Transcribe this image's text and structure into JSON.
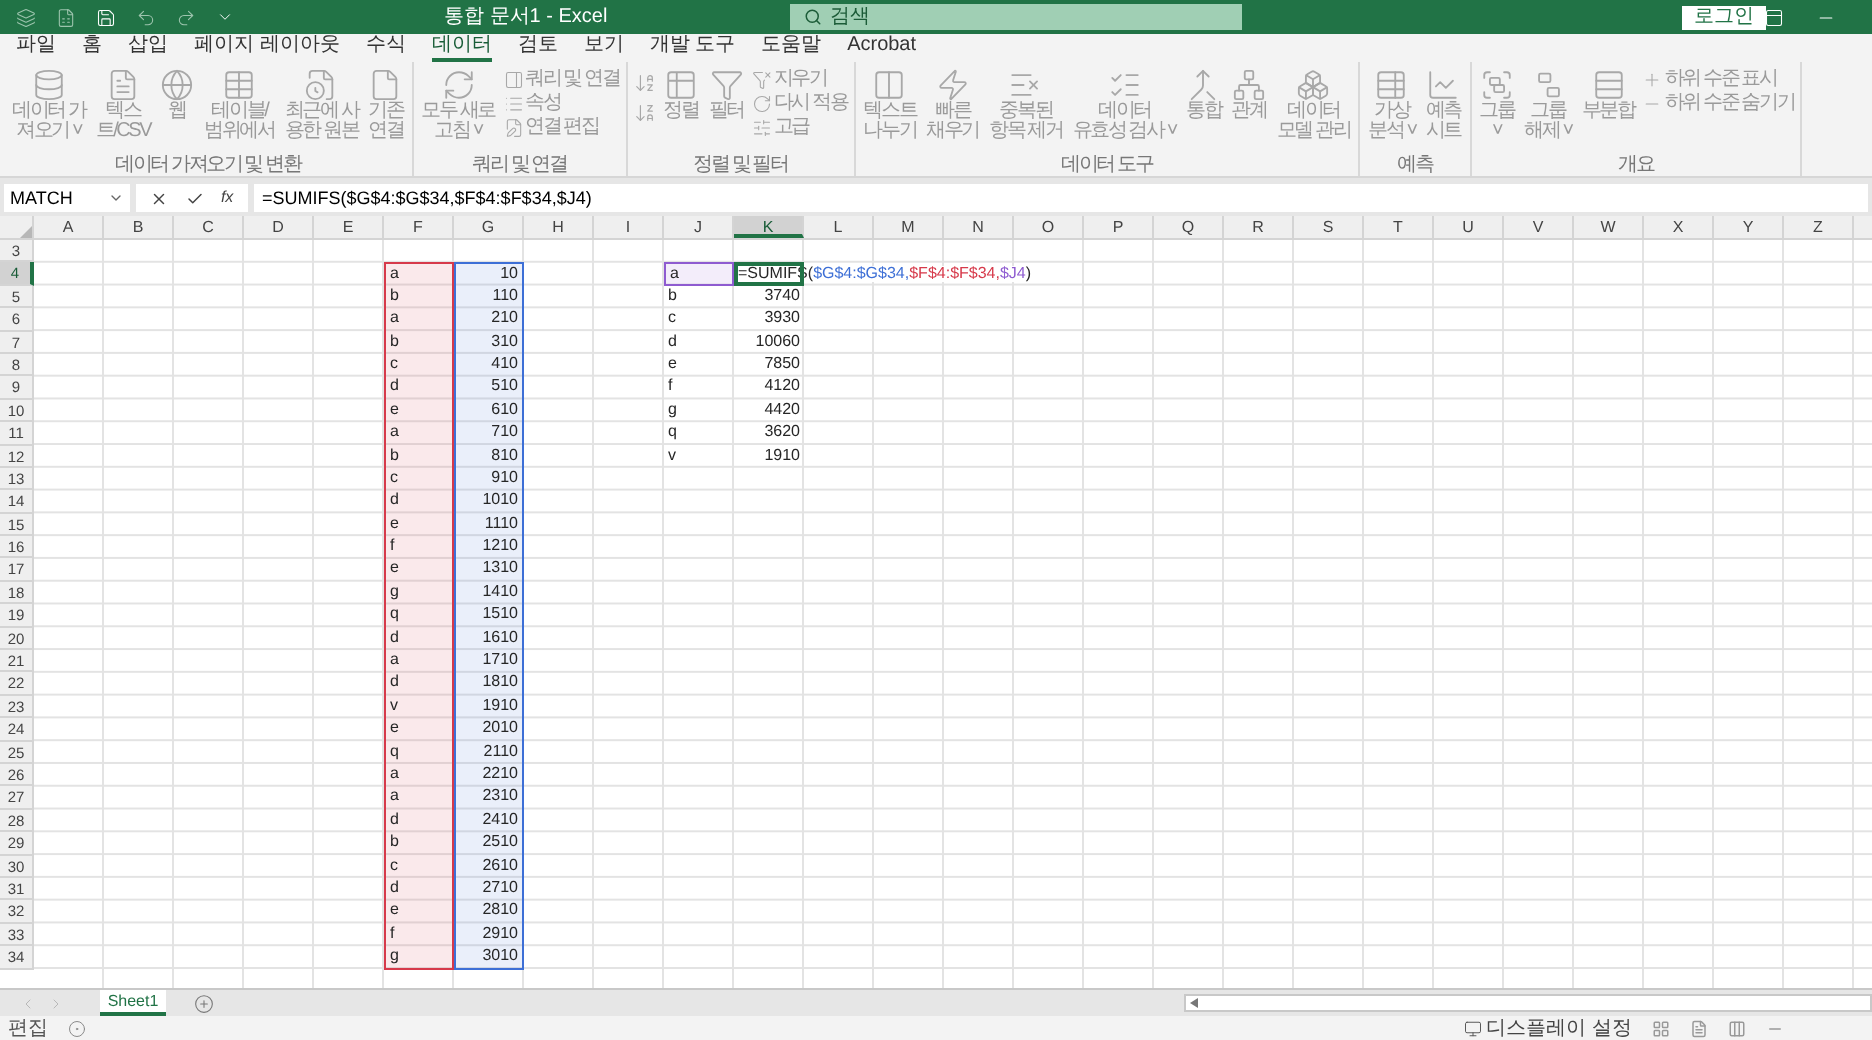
{
  "title_bar": {
    "title": "통합 문서1 - Excel",
    "search": {
      "placeholder": "검색"
    },
    "sign_in": "로그인"
  },
  "tabs": [
    {
      "label": "파일",
      "selected": false
    },
    {
      "label": "홈",
      "selected": false
    },
    {
      "label": "삽입",
      "selected": false
    },
    {
      "label": "페이지 레이아웃",
      "selected": false
    },
    {
      "label": "수식",
      "selected": false
    },
    {
      "label": "데이터",
      "selected": true
    },
    {
      "label": "검토",
      "selected": false
    },
    {
      "label": "보기",
      "selected": false
    },
    {
      "label": "개발 도구",
      "selected": false
    },
    {
      "label": "도움말",
      "selected": false
    },
    {
      "label": "Acrobat",
      "selected": false
    }
  ],
  "ribbon": {
    "disabled": true,
    "groups": [
      {
        "label": "데이터 가져오기 및 변환",
        "items": [
          {
            "kind": "large",
            "lines": [
              "데이터 가",
              "져오기 ˅"
            ]
          },
          {
            "kind": "large",
            "lines": [
              "텍스",
              "트/CSV"
            ]
          },
          {
            "kind": "large",
            "lines": [
              "웹"
            ]
          },
          {
            "kind": "large",
            "lines": [
              "테이블/",
              "범위에서"
            ]
          },
          {
            "kind": "large",
            "lines": [
              "최근에 사",
              "용한 원본"
            ]
          },
          {
            "kind": "large",
            "lines": [
              "기존",
              "연결"
            ]
          }
        ]
      },
      {
        "label": "쿼리 및 연결",
        "items": [
          {
            "kind": "large",
            "lines": [
              "모두 새로",
              "고침 ˅"
            ]
          },
          {
            "kind": "stack",
            "labels": [
              "쿼리 및 연결",
              "속성",
              "연결 편집"
            ]
          }
        ]
      },
      {
        "label": "정렬 및 필터",
        "items": [
          {
            "kind": "sort"
          },
          {
            "kind": "large",
            "lines": [
              "정렬"
            ]
          },
          {
            "kind": "large",
            "lines": [
              "필터"
            ]
          },
          {
            "kind": "stack",
            "labels": [
              "지우기",
              "다시 적용",
              "고급"
            ]
          }
        ]
      },
      {
        "label": "데이터 도구",
        "items": [
          {
            "kind": "large",
            "lines": [
              "텍스트",
              "나누기"
            ]
          },
          {
            "kind": "large",
            "lines": [
              "빠른",
              "채우기"
            ]
          },
          {
            "kind": "large",
            "lines": [
              "중복된",
              "항목 제거"
            ]
          },
          {
            "kind": "large",
            "lines": [
              "데이터",
              "유효성 검사 ˅"
            ]
          },
          {
            "kind": "large",
            "lines": [
              "통합"
            ]
          },
          {
            "kind": "large",
            "lines": [
              "관계"
            ]
          },
          {
            "kind": "large",
            "lines": [
              "데이터",
              "모델 관리"
            ]
          }
        ]
      },
      {
        "label": "예측",
        "items": [
          {
            "kind": "large",
            "lines": [
              "가상",
              "분석 ˅"
            ]
          },
          {
            "kind": "large",
            "lines": [
              "예측",
              "시트"
            ]
          }
        ]
      },
      {
        "label": "개요",
        "items": [
          {
            "kind": "large",
            "lines": [
              "그룹",
              "˅"
            ]
          },
          {
            "kind": "large",
            "lines": [
              "그룹",
              "해제 ˅"
            ]
          },
          {
            "kind": "large",
            "lines": [
              "부분합"
            ]
          },
          {
            "kind": "stack",
            "labels": [
              "하위 수준 표시",
              "하위 수준 숨기기"
            ]
          }
        ]
      }
    ]
  },
  "formula_bar": {
    "name_box": "MATCH",
    "function_button": "fx",
    "formula": "=SUMIFS($G$4:$G$34,$F$4:$F$34,$J4)"
  },
  "sheet": {
    "columns": [
      {
        "label": "A",
        "selected": false
      },
      {
        "label": "B",
        "selected": false
      },
      {
        "label": "C",
        "selected": false
      },
      {
        "label": "D",
        "selected": false
      },
      {
        "label": "E",
        "selected": false
      },
      {
        "label": "F",
        "selected": false
      },
      {
        "label": "G",
        "selected": false
      },
      {
        "label": "H",
        "selected": false
      },
      {
        "label": "I",
        "selected": false
      },
      {
        "label": "J",
        "selected": false
      },
      {
        "label": "K",
        "selected": true
      },
      {
        "label": "L",
        "selected": false
      },
      {
        "label": "M",
        "selected": false
      },
      {
        "label": "N",
        "selected": false
      },
      {
        "label": "O",
        "selected": false
      },
      {
        "label": "P",
        "selected": false
      },
      {
        "label": "Q",
        "selected": false
      },
      {
        "label": "R",
        "selected": false
      },
      {
        "label": "S",
        "selected": false
      },
      {
        "label": "T",
        "selected": false
      },
      {
        "label": "U",
        "selected": false
      },
      {
        "label": "V",
        "selected": false
      },
      {
        "label": "W",
        "selected": false
      },
      {
        "label": "X",
        "selected": false
      },
      {
        "label": "Y",
        "selected": false
      },
      {
        "label": "Z",
        "selected": false
      }
    ],
    "rows": [
      {
        "label": "3",
        "selected": false
      },
      {
        "label": "4",
        "selected": true,
        "F": {
          "text": "a",
          "color": "#d6394a"
        },
        "G": {
          "text": "10",
          "color": "#3d6fd6"
        },
        "J": {
          "text": "a",
          "color": "#8e5bd0"
        },
        "K": {
          "active": true,
          "formula": [
            {
              "text": "=SUMIFS(",
              "color": "#262626"
            },
            {
              "text": "$G$4:$G$34,",
              "color": "#3d6fd6"
            },
            {
              "text": "$F$4:$F$34,",
              "color": "#d6394a"
            },
            {
              "text": "$J4",
              "color": "#8e5bd0"
            },
            {
              "text": ")",
              "color": "#262626"
            }
          ]
        }
      },
      {
        "label": "5",
        "selected": false,
        "F": {
          "text": "b",
          "color": "#d6394a"
        },
        "G": {
          "text": "110",
          "color": "#3d6fd6"
        },
        "J": {
          "text": "b"
        },
        "K": {
          "text": "3740"
        }
      },
      {
        "label": "6",
        "selected": false,
        "F": {
          "text": "a",
          "color": "#d6394a"
        },
        "G": {
          "text": "210",
          "color": "#3d6fd6"
        },
        "J": {
          "text": "c"
        },
        "K": {
          "text": "3930"
        }
      },
      {
        "label": "7",
        "selected": false,
        "F": {
          "text": "b",
          "color": "#d6394a"
        },
        "G": {
          "text": "310",
          "color": "#3d6fd6"
        },
        "J": {
          "text": "d"
        },
        "K": {
          "text": "10060"
        }
      },
      {
        "label": "8",
        "selected": false,
        "F": {
          "text": "c",
          "color": "#d6394a"
        },
        "G": {
          "text": "410",
          "color": "#3d6fd6"
        },
        "J": {
          "text": "e"
        },
        "K": {
          "text": "7850"
        }
      },
      {
        "label": "9",
        "selected": false,
        "F": {
          "text": "d",
          "color": "#d6394a"
        },
        "G": {
          "text": "510",
          "color": "#3d6fd6"
        },
        "J": {
          "text": "f"
        },
        "K": {
          "text": "4120"
        }
      },
      {
        "label": "10",
        "selected": false,
        "F": {
          "text": "e",
          "color": "#d6394a"
        },
        "G": {
          "text": "610",
          "color": "#3d6fd6"
        },
        "J": {
          "text": "g"
        },
        "K": {
          "text": "4420"
        }
      },
      {
        "label": "11",
        "selected": false,
        "F": {
          "text": "a",
          "color": "#d6394a"
        },
        "G": {
          "text": "710",
          "color": "#3d6fd6"
        },
        "J": {
          "text": "q"
        },
        "K": {
          "text": "3620"
        }
      },
      {
        "label": "12",
        "selected": false,
        "F": {
          "text": "b",
          "color": "#d6394a"
        },
        "G": {
          "text": "810",
          "color": "#3d6fd6"
        },
        "J": {
          "text": "v"
        },
        "K": {
          "text": "1910"
        }
      },
      {
        "label": "13",
        "selected": false,
        "F": {
          "text": "c",
          "color": "#d6394a"
        },
        "G": {
          "text": "910",
          "color": "#3d6fd6"
        }
      },
      {
        "label": "14",
        "selected": false,
        "F": {
          "text": "d",
          "color": "#d6394a"
        },
        "G": {
          "text": "1010",
          "color": "#3d6fd6"
        }
      },
      {
        "label": "15",
        "selected": false,
        "F": {
          "text": "e",
          "color": "#d6394a"
        },
        "G": {
          "text": "1110",
          "color": "#3d6fd6"
        }
      },
      {
        "label": "16",
        "selected": false,
        "F": {
          "text": "f",
          "color": "#d6394a"
        },
        "G": {
          "text": "1210",
          "color": "#3d6fd6"
        }
      },
      {
        "label": "17",
        "selected": false,
        "F": {
          "text": "e",
          "color": "#d6394a"
        },
        "G": {
          "text": "1310",
          "color": "#3d6fd6"
        }
      },
      {
        "label": "18",
        "selected": false,
        "F": {
          "text": "g",
          "color": "#d6394a"
        },
        "G": {
          "text": "1410",
          "color": "#3d6fd6"
        }
      },
      {
        "label": "19",
        "selected": false,
        "F": {
          "text": "q",
          "color": "#d6394a"
        },
        "G": {
          "text": "1510",
          "color": "#3d6fd6"
        }
      },
      {
        "label": "20",
        "selected": false,
        "F": {
          "text": "d",
          "color": "#d6394a"
        },
        "G": {
          "text": "1610",
          "color": "#3d6fd6"
        }
      },
      {
        "label": "21",
        "selected": false,
        "F": {
          "text": "a",
          "color": "#d6394a"
        },
        "G": {
          "text": "1710",
          "color": "#3d6fd6"
        }
      },
      {
        "label": "22",
        "selected": false,
        "F": {
          "text": "d",
          "color": "#d6394a"
        },
        "G": {
          "text": "1810",
          "color": "#3d6fd6"
        }
      },
      {
        "label": "23",
        "selected": false,
        "F": {
          "text": "v",
          "color": "#d6394a"
        },
        "G": {
          "text": "1910",
          "color": "#3d6fd6"
        }
      },
      {
        "label": "24",
        "selected": false,
        "F": {
          "text": "e",
          "color": "#d6394a"
        },
        "G": {
          "text": "2010",
          "color": "#3d6fd6"
        }
      },
      {
        "label": "25",
        "selected": false,
        "F": {
          "text": "q",
          "color": "#d6394a"
        },
        "G": {
          "text": "2110",
          "color": "#3d6fd6"
        }
      },
      {
        "label": "26",
        "selected": false,
        "F": {
          "text": "a",
          "color": "#d6394a"
        },
        "G": {
          "text": "2210",
          "color": "#3d6fd6"
        }
      },
      {
        "label": "27",
        "selected": false,
        "F": {
          "text": "a",
          "color": "#d6394a"
        },
        "G": {
          "text": "2310",
          "color": "#3d6fd6"
        }
      },
      {
        "label": "28",
        "selected": false,
        "F": {
          "text": "d",
          "color": "#d6394a"
        },
        "G": {
          "text": "2410",
          "color": "#3d6fd6"
        }
      },
      {
        "label": "29",
        "selected": false,
        "F": {
          "text": "b",
          "color": "#d6394a"
        },
        "G": {
          "text": "2510",
          "color": "#3d6fd6"
        }
      },
      {
        "label": "30",
        "selected": false,
        "F": {
          "text": "c",
          "color": "#d6394a"
        },
        "G": {
          "text": "2610",
          "color": "#3d6fd6"
        }
      },
      {
        "label": "31",
        "selected": false,
        "F": {
          "text": "d",
          "color": "#d6394a"
        },
        "G": {
          "text": "2710",
          "color": "#3d6fd6"
        }
      },
      {
        "label": "32",
        "selected": false,
        "F": {
          "text": "e",
          "color": "#d6394a"
        },
        "G": {
          "text": "2810",
          "color": "#3d6fd6"
        }
      },
      {
        "label": "33",
        "selected": false,
        "F": {
          "text": "f",
          "color": "#d6394a"
        },
        "G": {
          "text": "2910",
          "color": "#3d6fd6"
        }
      },
      {
        "label": "34",
        "selected": false,
        "F": {
          "text": "g",
          "color": "#d6394a"
        },
        "G": {
          "text": "3010",
          "color": "#3d6fd6"
        }
      }
    ]
  },
  "sheet_tabs": [
    {
      "label": "Sheet1",
      "selected": true
    }
  ],
  "status_bar": {
    "mode": "편집",
    "display_settings": "디스플레이 설정"
  }
}
